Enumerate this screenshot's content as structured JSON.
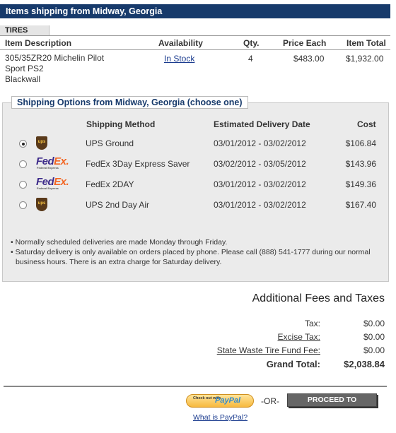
{
  "header": {
    "title": "Items shipping from Midway, Georgia"
  },
  "category": {
    "label": "TIRES"
  },
  "items_table": {
    "columns": [
      "Item Description",
      "Availability",
      "Qty.",
      "Price Each",
      "Item Total"
    ],
    "rows": [
      {
        "desc_line1": "305/35ZR20 Michelin Pilot",
        "desc_line2": "Sport PS2",
        "desc_line3": "Blackwall",
        "availability": "In Stock",
        "qty": "4",
        "price_each": "$483.00",
        "item_total": "$1,932.00"
      }
    ]
  },
  "shipping": {
    "title": "Shipping Options from Midway, Georgia (choose one)",
    "columns": {
      "method": "Shipping Method",
      "date": "Estimated Delivery Date",
      "cost": "Cost"
    },
    "options": [
      {
        "carrier": "ups-logo",
        "method": "UPS Ground",
        "date": "03/01/2012 - 03/02/2012",
        "cost": "$106.84",
        "selected": true
      },
      {
        "carrier": "fedex-logo",
        "method": "FedEx 3Day Express Saver",
        "date": "03/02/2012 - 03/05/2012",
        "cost": "$143.96",
        "selected": false
      },
      {
        "carrier": "fedex-logo",
        "method": "FedEx 2DAY",
        "date": "03/01/2012 - 03/02/2012",
        "cost": "$149.36",
        "selected": false
      },
      {
        "carrier": "ups-logo",
        "method": "UPS 2nd Day Air",
        "date": "03/01/2012 - 03/02/2012",
        "cost": "$167.40",
        "selected": false
      }
    ],
    "notes": [
      "Normally scheduled deliveries are made Monday through Friday.",
      "Saturday delivery is only available on orders placed by phone. Please call (888) 541-1777 during our normal business hours. There is an extra charge for Saturday delivery."
    ]
  },
  "fees": {
    "title": "Additional Fees and Taxes",
    "tax_label": "Tax:",
    "tax_value": "$0.00",
    "excise_label": "Excise Tax:",
    "excise_value": "$0.00",
    "waste_label": "State Waste Tire Fund Fee:",
    "waste_value": "$0.00",
    "grand_label": "Grand Total:",
    "grand_value": "$2,038.84"
  },
  "checkout": {
    "paypal_small": "Check out with",
    "paypal_brand_a": "Pay",
    "paypal_brand_b": "Pal",
    "or_text": "-OR-",
    "proceed_label": "PROCEED TO CHECKOUT",
    "what_paypal": "What is PayPal?"
  },
  "logos": {
    "ups_text": "ups",
    "fedex_fed": "Fed",
    "fedex_ex": "Ex.",
    "fedex_sub": "Federal Express"
  },
  "colors": {
    "header_bg": "#173a6b",
    "link": "#1a3b8e",
    "fedex_purple": "#3d2a8a",
    "fedex_orange": "#f26522",
    "ups_brown": "#5a3a1a"
  }
}
